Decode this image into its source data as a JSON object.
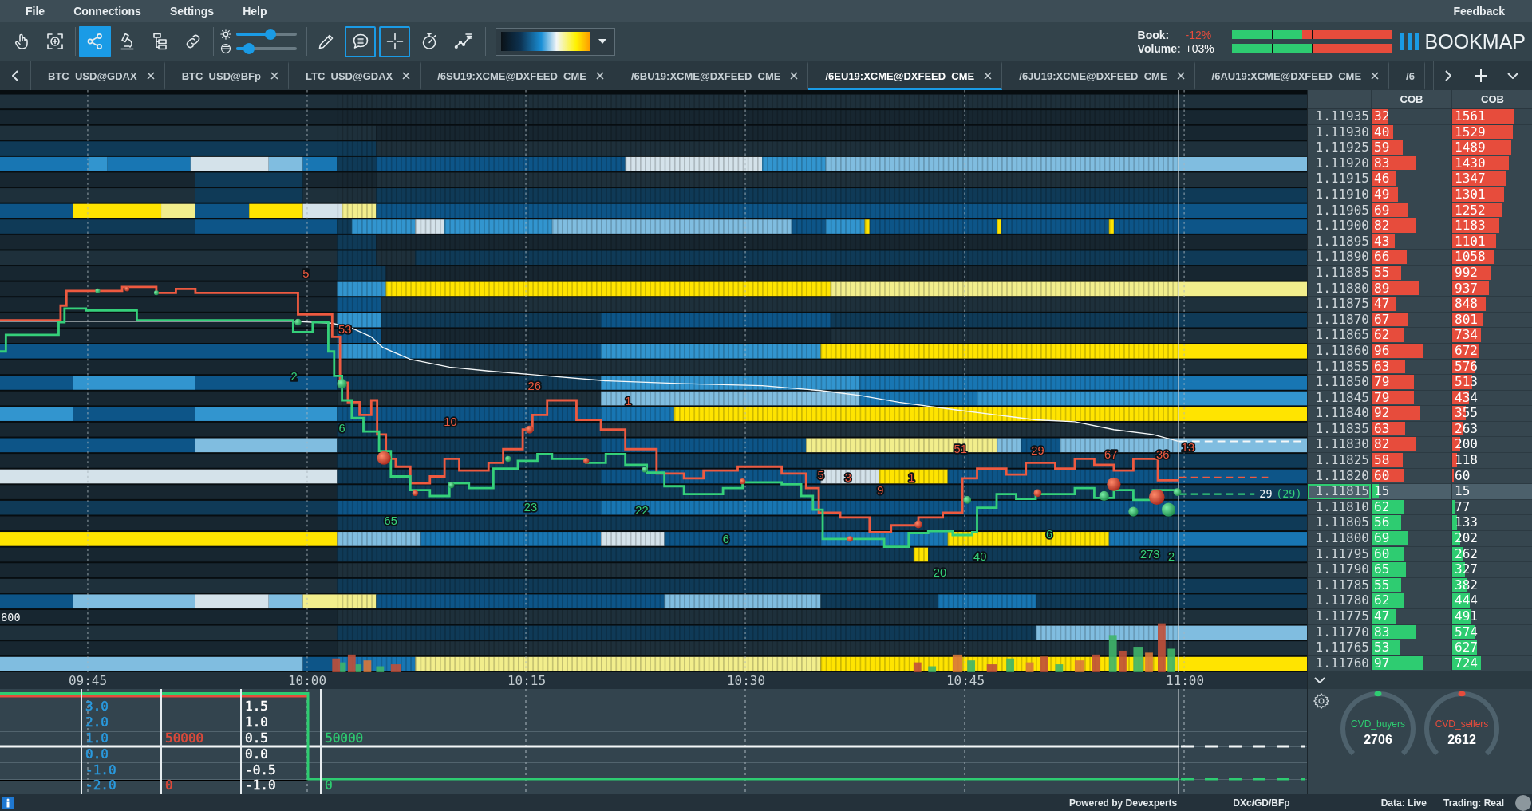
{
  "menu": {
    "items": [
      "File",
      "Connections",
      "Settings",
      "Help"
    ],
    "feedback": "Feedback"
  },
  "toolbar": {
    "tools_left": [
      {
        "kind": "hand",
        "selected": false
      },
      {
        "kind": "zoom",
        "selected": false
      }
    ],
    "tools_mode": [
      {
        "kind": "share",
        "selected": true
      },
      {
        "kind": "microscope",
        "selected": false
      },
      {
        "kind": "hierarchy",
        "selected": false
      },
      {
        "kind": "link",
        "selected": false
      }
    ],
    "sliders": [
      {
        "kind": "brightness",
        "level": 0.57
      },
      {
        "kind": "contrast",
        "level": 0.21
      }
    ],
    "tools_right": [
      {
        "kind": "pencil",
        "on": false
      },
      {
        "kind": "chat",
        "on": true
      },
      {
        "kind": "crosshair",
        "on": true
      },
      {
        "kind": "stopwatch",
        "on": false
      },
      {
        "kind": "chart",
        "on": false
      }
    ]
  },
  "balance": [
    {
      "label": "Book:",
      "value": "-12%",
      "color": "#e74c3c",
      "level": 0.44
    },
    {
      "label": "Volume:",
      "value": "+03%",
      "color": "#ffffff",
      "level": 0.51
    }
  ],
  "logo": "BOOKMAP",
  "tabs": [
    {
      "label": "BTC_USD@GDAX",
      "selected": false,
      "closable": true
    },
    {
      "label": "BTC_USD@BFp",
      "selected": false,
      "closable": true
    },
    {
      "label": "LTC_USD@GDAX",
      "selected": false,
      "closable": true
    },
    {
      "label": "/6SU19:XCME@DXFEED_CME",
      "selected": false,
      "closable": true
    },
    {
      "label": "/6BU19:XCME@DXFEED_CME",
      "selected": false,
      "closable": true
    },
    {
      "label": "/6EU19:XCME@DXFEED_CME",
      "selected": true,
      "closable": true
    },
    {
      "label": "/6JU19:XCME@DXFEED_CME",
      "selected": false,
      "closable": true
    },
    {
      "label": "/6AU19:XCME@DXFEED_CME",
      "selected": false,
      "closable": true
    },
    {
      "label": "/6",
      "selected": false,
      "closable": false
    }
  ],
  "heatmap": {
    "trade_labels": [
      {
        "text": "5",
        "kind": "ask"
      },
      {
        "text": "53",
        "kind": "ask"
      },
      {
        "text": "2",
        "kind": "bid"
      },
      {
        "text": "26",
        "kind": "ask"
      },
      {
        "text": "1",
        "kind": "ask"
      },
      {
        "text": "6",
        "kind": "bid"
      },
      {
        "text": "10",
        "kind": "ask"
      },
      {
        "text": "51",
        "kind": "ask"
      },
      {
        "text": "29",
        "kind": "ask"
      },
      {
        "text": "67",
        "kind": "ask"
      },
      {
        "text": "36",
        "kind": "ask"
      },
      {
        "text": "13",
        "kind": "ask"
      },
      {
        "text": "5",
        "kind": "ask"
      },
      {
        "text": "3",
        "kind": "ask"
      },
      {
        "text": "1",
        "kind": "ask"
      },
      {
        "text": "9",
        "kind": "ask"
      },
      {
        "text": "23",
        "kind": "bid"
      },
      {
        "text": "22",
        "kind": "bid"
      },
      {
        "text": "65",
        "kind": "bid"
      },
      {
        "text": "6",
        "kind": "bid"
      },
      {
        "text": "6",
        "kind": "bid"
      },
      {
        "text": "40",
        "kind": "bid"
      },
      {
        "text": "273",
        "kind": "bid"
      },
      {
        "text": "2",
        "kind": "bid"
      },
      {
        "text": "20",
        "kind": "bid"
      }
    ],
    "scale_label": "800",
    "last_size": "29",
    "last_size_total": "(29)",
    "time_labels": [
      "09:45",
      "10:00",
      "10:15",
      "10:30",
      "10:45",
      "11:00"
    ]
  },
  "ladder": {
    "columns": [
      "COB",
      "COB"
    ],
    "rows": [
      {
        "price": "1.11935",
        "kind": "ask",
        "current": false,
        "cob": [
          {
            "value": "32",
            "level": 0.21
          },
          {
            "value": "1561",
            "level": 0.77
          }
        ]
      },
      {
        "price": "1.11930",
        "kind": "ask",
        "current": false,
        "cob": [
          {
            "value": "40",
            "level": 0.27
          },
          {
            "value": "1529",
            "level": 0.75
          }
        ]
      },
      {
        "price": "1.11925",
        "kind": "ask",
        "current": false,
        "cob": [
          {
            "value": "59",
            "level": 0.39
          },
          {
            "value": "1489",
            "level": 0.73
          }
        ]
      },
      {
        "price": "1.11920",
        "kind": "ask",
        "current": false,
        "cob": [
          {
            "value": "83",
            "level": 0.55
          },
          {
            "value": "1430",
            "level": 0.7
          }
        ]
      },
      {
        "price": "1.11915",
        "kind": "ask",
        "current": false,
        "cob": [
          {
            "value": "46",
            "level": 0.31
          },
          {
            "value": "1347",
            "level": 0.66
          }
        ]
      },
      {
        "price": "1.11910",
        "kind": "ask",
        "current": false,
        "cob": [
          {
            "value": "49",
            "level": 0.33
          },
          {
            "value": "1301",
            "level": 0.64
          }
        ]
      },
      {
        "price": "1.11905",
        "kind": "ask",
        "current": false,
        "cob": [
          {
            "value": "69",
            "level": 0.46
          },
          {
            "value": "1252",
            "level": 0.62
          }
        ]
      },
      {
        "price": "1.11900",
        "kind": "ask",
        "current": false,
        "cob": [
          {
            "value": "82",
            "level": 0.55
          },
          {
            "value": "1183",
            "level": 0.58
          }
        ]
      },
      {
        "price": "1.11895",
        "kind": "ask",
        "current": false,
        "cob": [
          {
            "value": "43",
            "level": 0.29
          },
          {
            "value": "1101",
            "level": 0.54
          }
        ]
      },
      {
        "price": "1.11890",
        "kind": "ask",
        "current": false,
        "cob": [
          {
            "value": "66",
            "level": 0.44
          },
          {
            "value": "1058",
            "level": 0.52
          }
        ]
      },
      {
        "price": "1.11885",
        "kind": "ask",
        "current": false,
        "cob": [
          {
            "value": "55",
            "level": 0.37
          },
          {
            "value": "992",
            "level": 0.49
          }
        ]
      },
      {
        "price": "1.11880",
        "kind": "ask",
        "current": false,
        "cob": [
          {
            "value": "89",
            "level": 0.59
          },
          {
            "value": "937",
            "level": 0.46
          }
        ]
      },
      {
        "price": "1.11875",
        "kind": "ask",
        "current": false,
        "cob": [
          {
            "value": "47",
            "level": 0.31
          },
          {
            "value": "848",
            "level": 0.42
          }
        ]
      },
      {
        "price": "1.11870",
        "kind": "ask",
        "current": false,
        "cob": [
          {
            "value": "67",
            "level": 0.45
          },
          {
            "value": "801",
            "level": 0.39
          }
        ]
      },
      {
        "price": "1.11865",
        "kind": "ask",
        "current": false,
        "cob": [
          {
            "value": "62",
            "level": 0.41
          },
          {
            "value": "734",
            "level": 0.36
          }
        ]
      },
      {
        "price": "1.11860",
        "kind": "ask",
        "current": false,
        "cob": [
          {
            "value": "96",
            "level": 0.64
          },
          {
            "value": "672",
            "level": 0.33
          }
        ]
      },
      {
        "price": "1.11855",
        "kind": "ask",
        "current": false,
        "cob": [
          {
            "value": "63",
            "level": 0.42
          },
          {
            "value": "576",
            "level": 0.28
          }
        ]
      },
      {
        "price": "1.11850",
        "kind": "ask",
        "current": false,
        "cob": [
          {
            "value": "79",
            "level": 0.53
          },
          {
            "value": "513",
            "level": 0.25
          }
        ]
      },
      {
        "price": "1.11845",
        "kind": "ask",
        "current": false,
        "cob": [
          {
            "value": "79",
            "level": 0.53
          },
          {
            "value": "434",
            "level": 0.21
          }
        ]
      },
      {
        "price": "1.11840",
        "kind": "ask",
        "current": false,
        "cob": [
          {
            "value": "92",
            "level": 0.61
          },
          {
            "value": "355",
            "level": 0.17
          }
        ]
      },
      {
        "price": "1.11835",
        "kind": "ask",
        "current": false,
        "cob": [
          {
            "value": "63",
            "level": 0.42
          },
          {
            "value": "263",
            "level": 0.13
          }
        ]
      },
      {
        "price": "1.11830",
        "kind": "ask",
        "current": false,
        "cob": [
          {
            "value": "82",
            "level": 0.55
          },
          {
            "value": "200",
            "level": 0.1
          }
        ]
      },
      {
        "price": "1.11825",
        "kind": "ask",
        "current": false,
        "cob": [
          {
            "value": "58",
            "level": 0.39
          },
          {
            "value": "118",
            "level": 0.06
          }
        ]
      },
      {
        "price": "1.11820",
        "kind": "ask",
        "current": false,
        "cob": [
          {
            "value": "60",
            "level": 0.4
          },
          {
            "value": "60",
            "level": 0.02
          }
        ]
      },
      {
        "price": "1.11815",
        "kind": "bid",
        "current": true,
        "cob": [
          {
            "value": "15",
            "level": 0.09
          },
          {
            "value": "15",
            "level": 0
          }
        ]
      },
      {
        "price": "1.11810",
        "kind": "bid",
        "current": false,
        "cob": [
          {
            "value": "62",
            "level": 0.41
          },
          {
            "value": "77",
            "level": 0.03
          }
        ]
      },
      {
        "price": "1.11805",
        "kind": "bid",
        "current": false,
        "cob": [
          {
            "value": "56",
            "level": 0.37
          },
          {
            "value": "133",
            "level": 0.06
          }
        ]
      },
      {
        "price": "1.11800",
        "kind": "bid",
        "current": false,
        "cob": [
          {
            "value": "69",
            "level": 0.46
          },
          {
            "value": "202",
            "level": 0.1
          }
        ]
      },
      {
        "price": "1.11795",
        "kind": "bid",
        "current": false,
        "cob": [
          {
            "value": "60",
            "level": 0.4
          },
          {
            "value": "262",
            "level": 0.13
          }
        ]
      },
      {
        "price": "1.11790",
        "kind": "bid",
        "current": false,
        "cob": [
          {
            "value": "65",
            "level": 0.43
          },
          {
            "value": "327",
            "level": 0.16
          }
        ]
      },
      {
        "price": "1.11785",
        "kind": "bid",
        "current": false,
        "cob": [
          {
            "value": "55",
            "level": 0.37
          },
          {
            "value": "382",
            "level": 0.19
          }
        ]
      },
      {
        "price": "1.11780",
        "kind": "bid",
        "current": false,
        "cob": [
          {
            "value": "62",
            "level": 0.41
          },
          {
            "value": "444",
            "level": 0.22
          }
        ]
      },
      {
        "price": "1.11775",
        "kind": "bid",
        "current": false,
        "cob": [
          {
            "value": "47",
            "level": 0.31
          },
          {
            "value": "491",
            "level": 0.24
          }
        ]
      },
      {
        "price": "1.11770",
        "kind": "bid",
        "current": false,
        "cob": [
          {
            "value": "83",
            "level": 0.55
          },
          {
            "value": "574",
            "level": 0.28
          }
        ]
      },
      {
        "price": "1.11765",
        "kind": "bid",
        "current": false,
        "cob": [
          {
            "value": "53",
            "level": 0.35
          },
          {
            "value": "627",
            "level": 0.31
          }
        ]
      },
      {
        "price": "1.11760",
        "kind": "bid",
        "current": false,
        "cob": [
          {
            "value": "97",
            "level": 0.65
          },
          {
            "value": "724",
            "level": 0.36
          }
        ]
      }
    ]
  },
  "indicator": {
    "scales": [
      {
        "color": "#2a9be0",
        "labels": [
          "3.0",
          "2.0",
          "1.0",
          "0.0",
          "-1.0",
          "-2.0"
        ]
      },
      {
        "color": "#e04a3a",
        "labels": [
          "50000",
          "0"
        ]
      },
      {
        "color": "#ffffff",
        "labels": [
          "1.5",
          "1.0",
          "0.5",
          "0.0",
          "-0.5",
          "-1.0"
        ]
      },
      {
        "color": "#2ecc71",
        "labels": [
          "50000",
          "0"
        ]
      }
    ]
  },
  "gauges": [
    {
      "name": "CVD_buyers",
      "value": "2706",
      "color": "#2ecc71",
      "level": 0.5
    },
    {
      "name": "CVD_sellers",
      "value": "2612",
      "color": "#e74c3c",
      "level": 0.5
    }
  ],
  "status_bar": {
    "powered_by": "Powered by Devexperts",
    "feeds": "DXc/GD/BFp",
    "data": "Data: Live",
    "trading": "Trading: Real"
  }
}
